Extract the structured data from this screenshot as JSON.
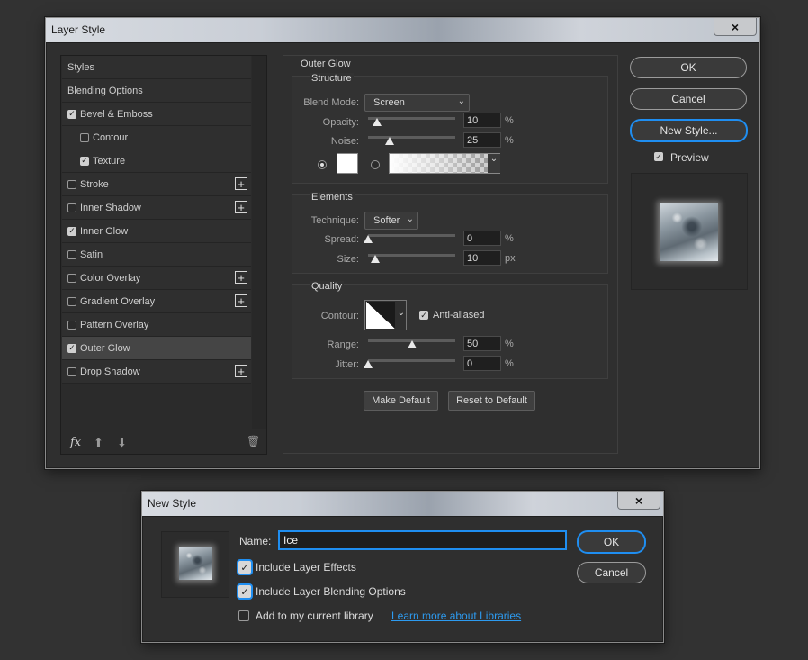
{
  "layer_style": {
    "title": "Layer Style",
    "close_icon": "×",
    "styles_list": [
      {
        "label": "Styles",
        "checkbox": false,
        "checked": false,
        "indent": 0,
        "plus": false,
        "selected": false
      },
      {
        "label": "Blending Options",
        "checkbox": false,
        "checked": false,
        "indent": 0,
        "plus": false,
        "selected": false
      },
      {
        "label": "Bevel & Emboss",
        "checkbox": true,
        "checked": true,
        "indent": 0,
        "plus": false,
        "selected": false
      },
      {
        "label": "Contour",
        "checkbox": true,
        "checked": false,
        "indent": 1,
        "plus": false,
        "selected": false
      },
      {
        "label": "Texture",
        "checkbox": true,
        "checked": true,
        "indent": 1,
        "plus": false,
        "selected": false
      },
      {
        "label": "Stroke",
        "checkbox": true,
        "checked": false,
        "indent": 0,
        "plus": true,
        "selected": false
      },
      {
        "label": "Inner Shadow",
        "checkbox": true,
        "checked": false,
        "indent": 0,
        "plus": true,
        "selected": false
      },
      {
        "label": "Inner Glow",
        "checkbox": true,
        "checked": true,
        "indent": 0,
        "plus": false,
        "selected": false
      },
      {
        "label": "Satin",
        "checkbox": true,
        "checked": false,
        "indent": 0,
        "plus": false,
        "selected": false
      },
      {
        "label": "Color Overlay",
        "checkbox": true,
        "checked": false,
        "indent": 0,
        "plus": true,
        "selected": false
      },
      {
        "label": "Gradient Overlay",
        "checkbox": true,
        "checked": false,
        "indent": 0,
        "plus": true,
        "selected": false
      },
      {
        "label": "Pattern Overlay",
        "checkbox": true,
        "checked": false,
        "indent": 0,
        "plus": false,
        "selected": false
      },
      {
        "label": "Outer Glow",
        "checkbox": true,
        "checked": true,
        "indent": 0,
        "plus": false,
        "selected": true
      },
      {
        "label": "Drop Shadow",
        "checkbox": true,
        "checked": false,
        "indent": 0,
        "plus": true,
        "selected": false
      }
    ],
    "footer": {
      "fx": "fx",
      "up_icon": "⬆",
      "down_icon": "⬇",
      "trash_icon": "🗑"
    },
    "outer_glow": {
      "heading": "Outer Glow",
      "structure": {
        "title": "Structure",
        "blend_mode_label": "Blend Mode:",
        "blend_mode_value": "Screen",
        "opacity_label": "Opacity:",
        "opacity_value": "10",
        "opacity_pct": 10,
        "noise_label": "Noise:",
        "noise_value": "25",
        "noise_pct": 25,
        "unit_pct": "%",
        "color_swatch": "#ffffff"
      },
      "elements": {
        "title": "Elements",
        "technique_label": "Technique:",
        "technique_value": "Softer",
        "spread_label": "Spread:",
        "spread_value": "0",
        "spread_pct": 0,
        "size_label": "Size:",
        "size_value": "10",
        "size_pct": 8,
        "unit_pct": "%",
        "unit_px": "px"
      },
      "quality": {
        "title": "Quality",
        "contour_label": "Contour:",
        "anti_aliased_label": "Anti-aliased",
        "anti_aliased": true,
        "range_label": "Range:",
        "range_value": "50",
        "range_pct": 50,
        "jitter_label": "Jitter:",
        "jitter_value": "0",
        "jitter_pct": 0,
        "unit_pct": "%"
      },
      "make_default_label": "Make Default",
      "reset_default_label": "Reset to Default"
    },
    "buttons": {
      "ok": "OK",
      "cancel": "Cancel",
      "new_style": "New Style...",
      "preview_label": "Preview",
      "preview_checked": true
    }
  },
  "new_style": {
    "title": "New Style",
    "close_icon": "×",
    "name_label": "Name:",
    "name_value": "Ice",
    "include_effects_label": "Include Layer Effects",
    "include_effects": true,
    "include_blending_label": "Include Layer Blending Options",
    "include_blending": true,
    "add_library_label": "Add to my current library",
    "add_library": false,
    "learn_more_link": "Learn more about Libraries",
    "ok": "OK",
    "cancel": "Cancel"
  },
  "colors": {
    "accent": "#1f8ef1",
    "link": "#2d9bf0",
    "panel": "#323232"
  }
}
